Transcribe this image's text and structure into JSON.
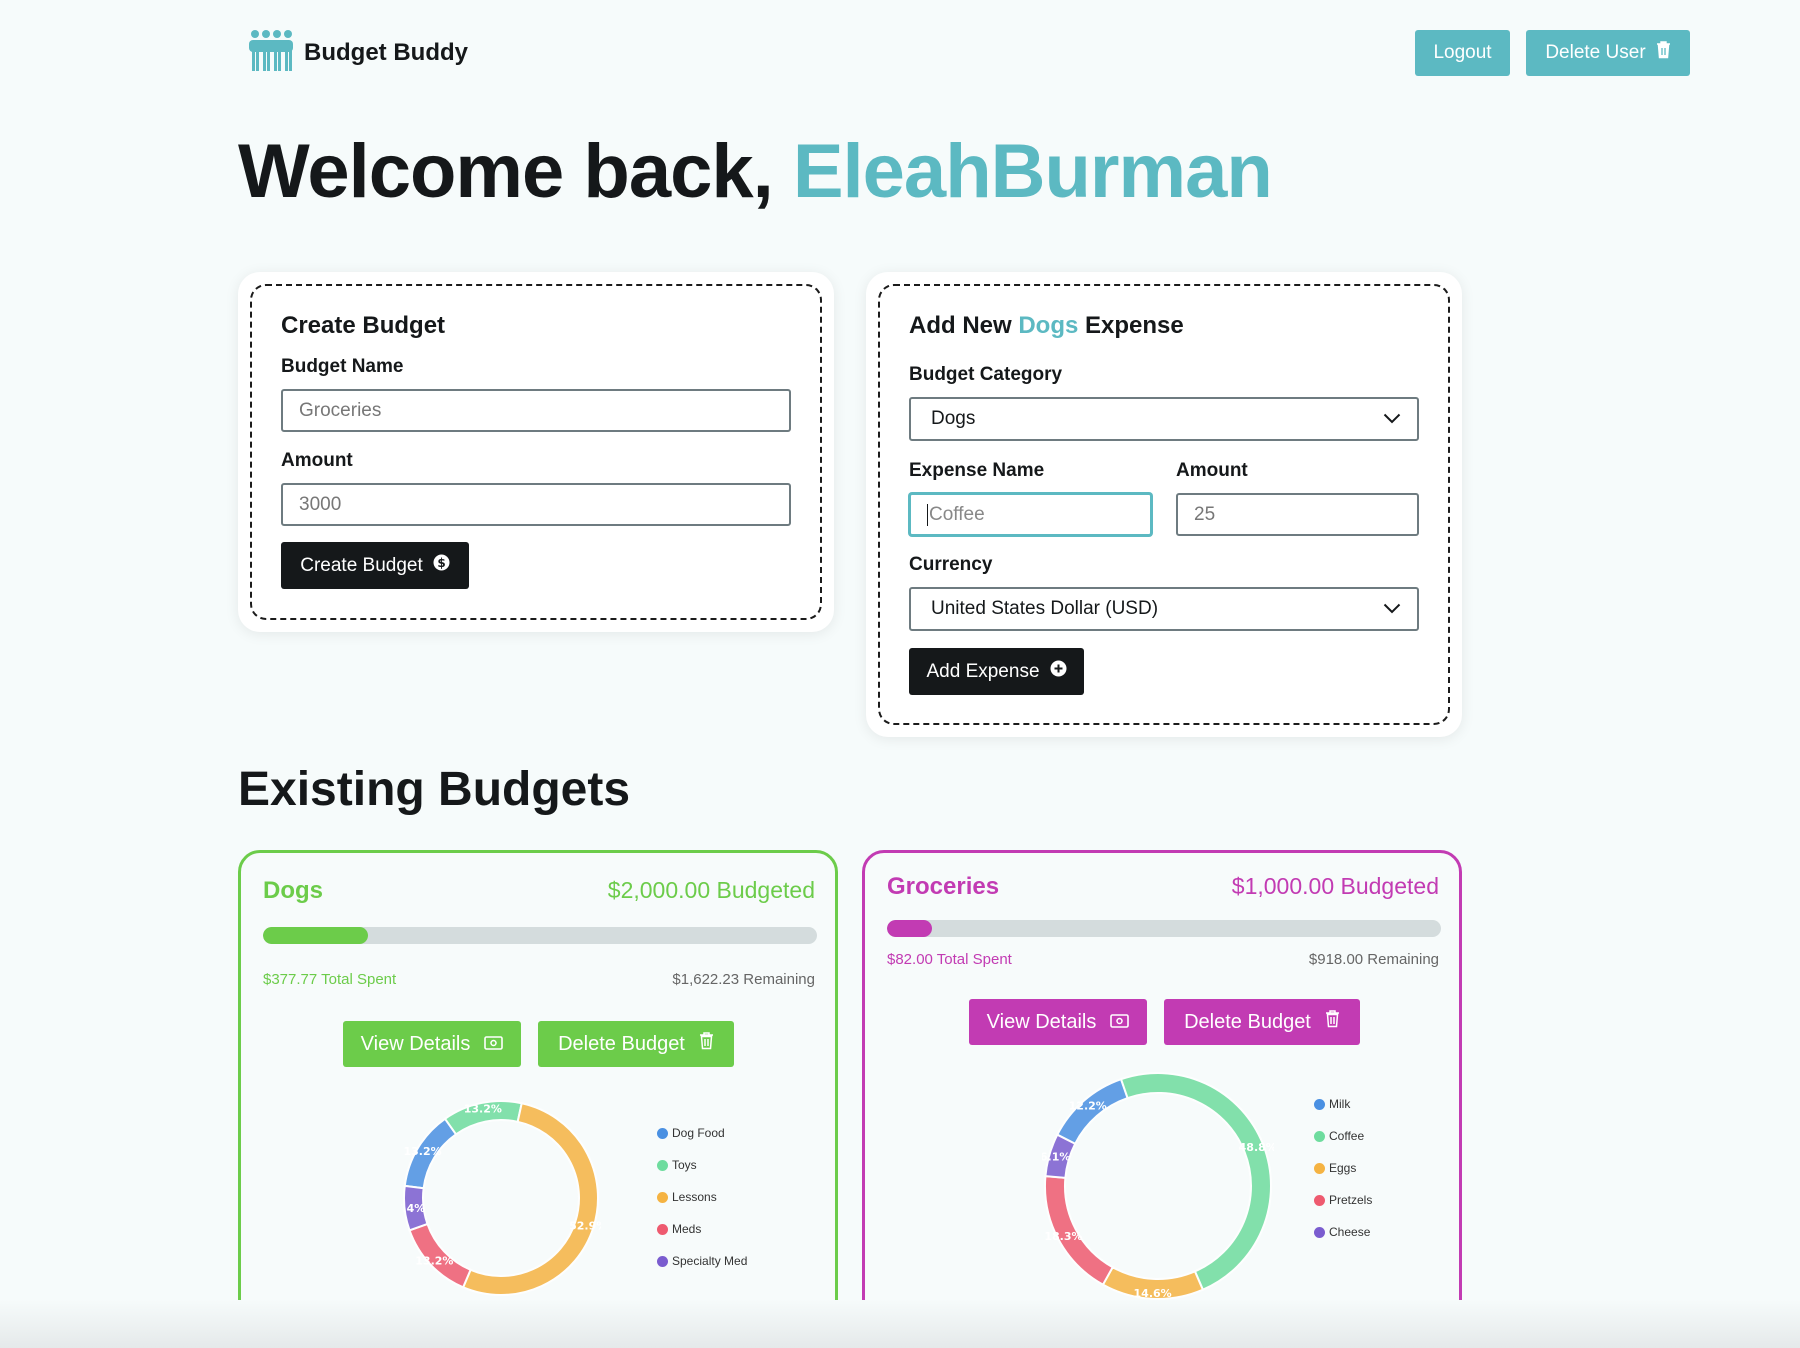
{
  "header": {
    "app_name": "Budget Buddy",
    "logout_label": "Logout",
    "delete_user_label": "Delete User"
  },
  "welcome": {
    "prefix": "Welcome back,",
    "username": "EleahBurman"
  },
  "create_budget": {
    "title": "Create Budget",
    "name_label": "Budget Name",
    "name_placeholder": "Groceries",
    "amount_label": "Amount",
    "amount_placeholder": "3000",
    "submit_label": "Create Budget"
  },
  "add_expense": {
    "title_prefix": "Add New",
    "title_category": "Dogs",
    "title_suffix": "Expense",
    "category_label": "Budget Category",
    "category_value": "Dogs",
    "expense_name_label": "Expense Name",
    "expense_name_placeholder": "Coffee",
    "amount_label": "Amount",
    "amount_placeholder": "25",
    "currency_label": "Currency",
    "currency_value": "United States Dollar (USD)",
    "submit_label": "Add Expense"
  },
  "existing_title": "Existing Budgets",
  "budgets": [
    {
      "name": "Dogs",
      "budgeted": "$2,000.00 Budgeted",
      "spent": "$377.77 Total Spent",
      "remaining": "$1,622.23 Remaining",
      "progress": 0.19,
      "color": "#6ccc4a",
      "view_label": "View Details",
      "delete_label": "Delete Budget",
      "chart_data": {
        "type": "pie",
        "labels": [
          "Dog Food",
          "Toys",
          "Lessons",
          "Meds",
          "Specialty Med"
        ],
        "values": [
          13.2,
          13.2,
          52.9,
          13.2,
          7.4
        ],
        "value_labels": [
          "13.2%",
          "13.2%",
          "52.9%",
          "13.2%",
          "7.4%"
        ],
        "colors": [
          "#4a90e2",
          "#6edc9e",
          "#f5b342",
          "#ee5a6f",
          "#7a5ccf"
        ],
        "legend": "right"
      }
    },
    {
      "name": "Groceries",
      "budgeted": "$1,000.00 Budgeted",
      "spent": "$82.00 Total Spent",
      "remaining": "$918.00 Remaining",
      "progress": 0.082,
      "color": "#c23bb3",
      "view_label": "View Details",
      "delete_label": "Delete Budget",
      "chart_data": {
        "type": "pie",
        "labels": [
          "Milk",
          "Coffee",
          "Eggs",
          "Pretzels",
          "Cheese"
        ],
        "values": [
          12.2,
          48.8,
          14.6,
          18.3,
          6.1
        ],
        "value_labels": [
          "12.2%",
          "48.8%",
          "14.6%",
          "18.3%",
          "6.1%"
        ],
        "colors": [
          "#4a90e2",
          "#6edc9e",
          "#f5b342",
          "#ee5a6f",
          "#7a5ccf"
        ],
        "legend": "right"
      }
    }
  ]
}
